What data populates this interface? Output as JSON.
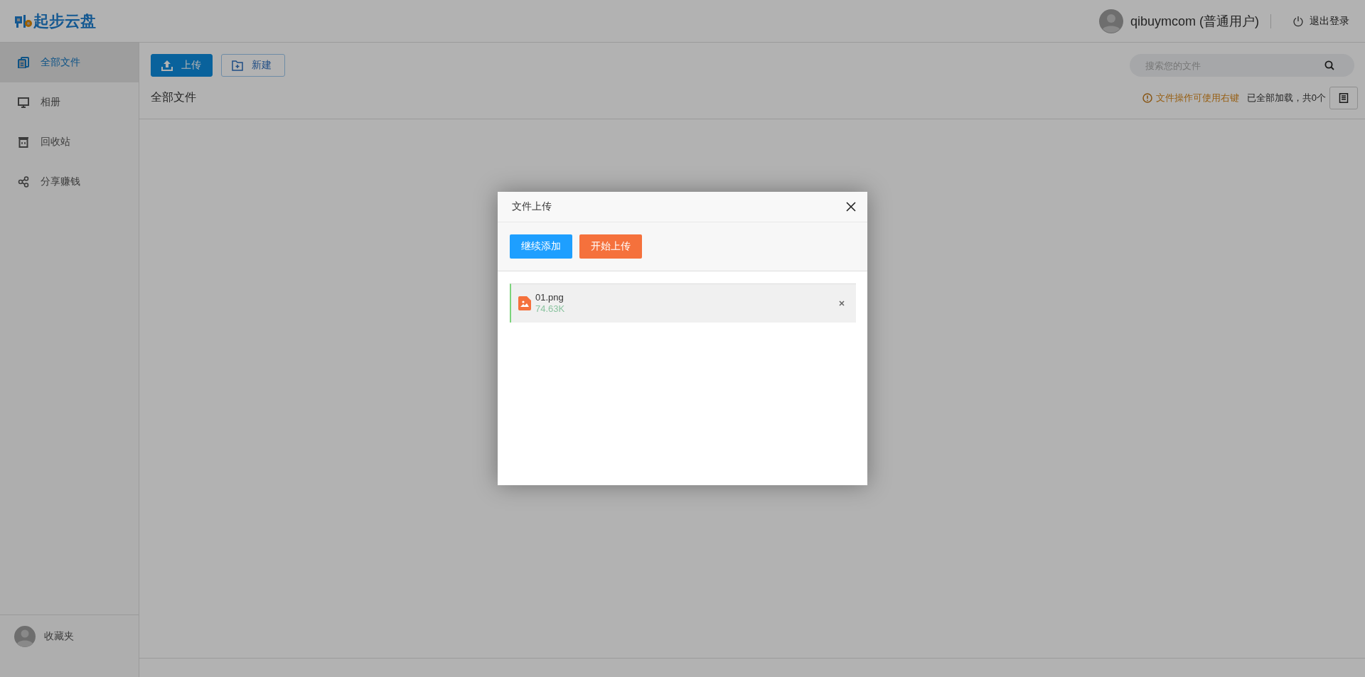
{
  "header": {
    "logo_text": "起步云盘",
    "user": "qibuymcom (普通用户)",
    "logout": "退出登录"
  },
  "sidebar": {
    "items": [
      {
        "label": "全部文件",
        "selected": true
      },
      {
        "label": "相册",
        "selected": false
      },
      {
        "label": "回收站",
        "selected": false
      },
      {
        "label": "分享赚钱",
        "selected": false
      }
    ],
    "footer": "收藏夹"
  },
  "toolbar": {
    "buttons": [
      {
        "label": "上传",
        "kind": "primary"
      },
      {
        "label": "新建",
        "kind": "outline"
      }
    ],
    "search": {
      "placeholder": "搜索您的文件"
    }
  },
  "breadcrumb": "全部文件",
  "tip": "文件操作可使用右键",
  "count": "已全部加载，共0个",
  "dialog": {
    "title": "文件上传",
    "buttons": [
      {
        "label": "继续添加",
        "kind": "add"
      },
      {
        "label": "开始上传",
        "kind": "start"
      }
    ],
    "files": [
      {
        "name": "01.png",
        "size": "74.63K"
      }
    ]
  }
}
